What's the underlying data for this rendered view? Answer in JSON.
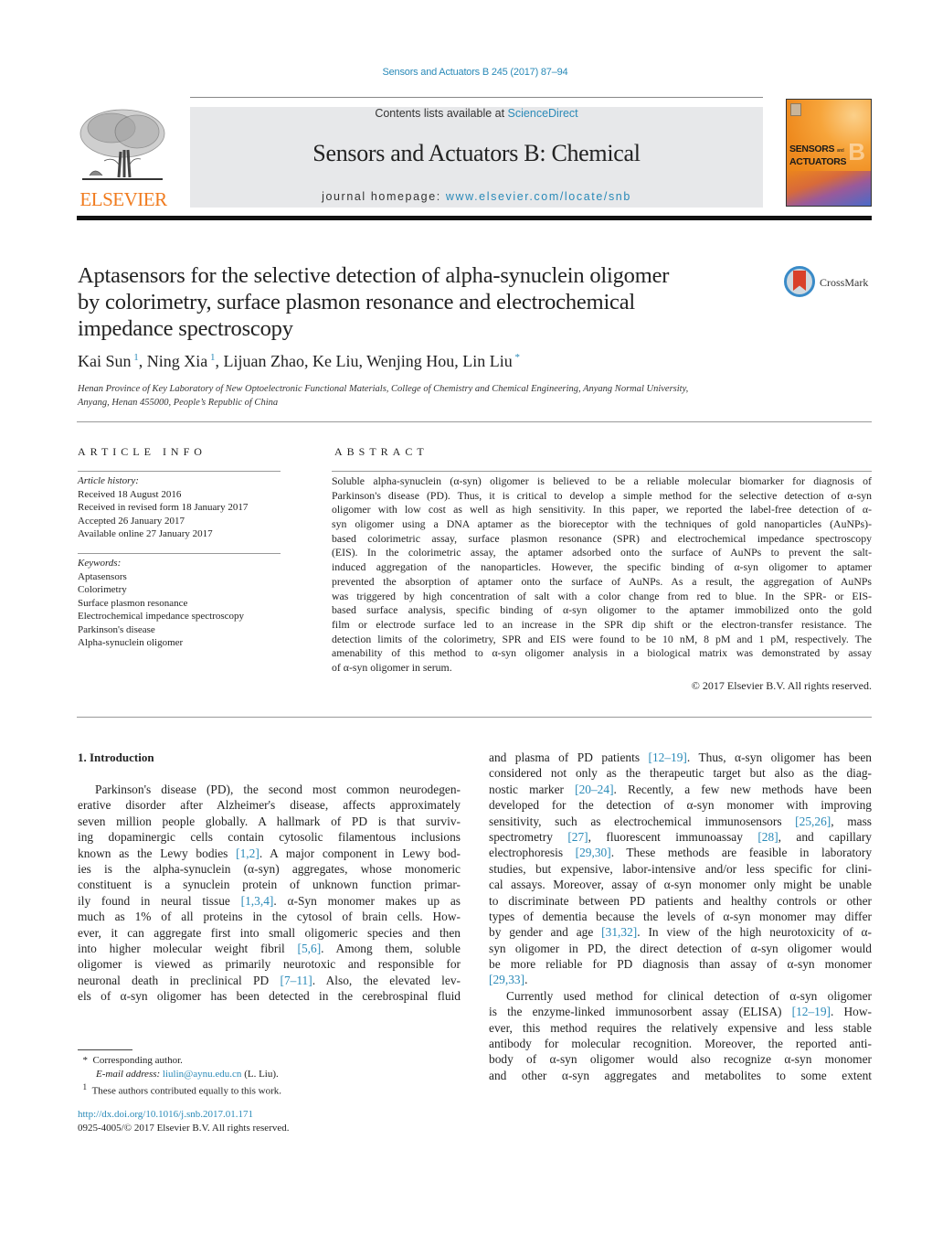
{
  "header": {
    "citation": "Sensors and Actuators B 245 (2017) 87–94",
    "contents_prefix": "Contents lists available at ",
    "contents_link": "ScienceDirect",
    "journal_title": "Sensors and Actuators B: Chemical",
    "homepage_prefix": "journal homepage: ",
    "homepage_link": "www.elsevier.com/locate/snb",
    "publisher_logo_text": "ELSEVIER",
    "cover": {
      "line1": "SENSORS",
      "and": "and",
      "line2": "ACTUATORS",
      "letter": "B"
    },
    "colors": {
      "link": "#2a8ab8",
      "elsevier_orange": "#f07b1e",
      "banner_bg": "#e7e8ea"
    }
  },
  "article": {
    "title_lines": [
      "Aptasensors for the selective detection of alpha-synuclein oligomer",
      "by colorimetry, surface plasmon resonance and electrochemical",
      "impedance spectroscopy"
    ],
    "crossmark_label": "CrossMark",
    "authors": [
      {
        "name": "Kai Sun",
        "mark": "1"
      },
      {
        "name": "Ning Xia",
        "mark": "1"
      },
      {
        "name": "Lijuan Zhao",
        "mark": ""
      },
      {
        "name": "Ke Liu",
        "mark": ""
      },
      {
        "name": "Wenjing Hou",
        "mark": ""
      },
      {
        "name": "Lin Liu",
        "mark": "*"
      }
    ],
    "affiliation_lines": [
      "Henan Province of Key Laboratory of New Optoelectronic Functional Materials, College of Chemistry and Chemical Engineering, Anyang Normal University,",
      "Anyang, Henan 455000, People’s Republic of China"
    ]
  },
  "article_info": {
    "heading": "ARTICLE INFO",
    "history_label": "Article history:",
    "history": [
      "Received 18 August 2016",
      "Received in revised form 18 January 2017",
      "Accepted 26 January 2017",
      "Available online 27 January 2017"
    ],
    "keywords_label": "Keywords:",
    "keywords": [
      "Aptasensors",
      "Colorimetry",
      "Surface plasmon resonance",
      "Electrochemical impedance spectroscopy",
      "Parkinson's disease",
      "Alpha-synuclein oligomer"
    ]
  },
  "abstract": {
    "heading": "ABSTRACT",
    "lines": [
      "Soluble alpha-synuclein (α-syn) oligomer is believed to be a reliable molecular biomarker for diagnosis of",
      "Parkinson's disease (PD). Thus, it is critical to develop a simple method for the selective detection of α-syn",
      "oligomer with low cost as well as high sensitivity. In this paper, we reported the label-free detection of α-",
      "syn oligomer using a DNA aptamer as the bioreceptor with the techniques of gold nanoparticles (AuNPs)-",
      "based colorimetric assay, surface plasmon resonance (SPR) and electrochemical impedance spectroscopy",
      "(EIS). In the colorimetric assay, the aptamer adsorbed onto the surface of AuNPs to prevent the salt-",
      "induced aggregation of the nanoparticles. However, the specific binding of α-syn oligomer to aptamer",
      "prevented the absorption of aptamer onto the surface of AuNPs. As a result, the aggregation of AuNPs",
      "was triggered by high concentration of salt with a color change from red to blue. In the SPR- or EIS-",
      "based surface analysis, specific binding of α-syn oligomer to the aptamer immobilized onto the gold",
      "film or electrode surface led to an increase in the SPR dip shift or the electron-transfer resistance. The",
      "detection limits of the colorimetry, SPR and EIS were found to be 10 nM, 8 pM and 1 pM, respectively. The",
      "amenability of this method to α-syn oligomer analysis in a biological matrix was demonstrated by assay",
      "of α-syn oligomer in serum."
    ],
    "copyright": "© 2017 Elsevier B.V. All rights reserved."
  },
  "introduction": {
    "heading": "1.  Introduction",
    "left_column": [
      {
        "segs": [
          {
            "t": "Parkinson's disease (PD), the second most common neurodegen-"
          }
        ],
        "indent": true
      },
      {
        "segs": [
          {
            "t": "erative disorder after Alzheimer's disease, affects approximately"
          }
        ]
      },
      {
        "segs": [
          {
            "t": "seven million people globally. A hallmark of PD is that surviv-"
          }
        ]
      },
      {
        "segs": [
          {
            "t": "ing dopaminergic cells contain cytosolic filamentous inclusions"
          }
        ]
      },
      {
        "segs": [
          {
            "t": "known as the Lewy bodies "
          },
          {
            "t": "[1,2]",
            "ref": true
          },
          {
            "t": ". A major component in Lewy bod-"
          }
        ]
      },
      {
        "segs": [
          {
            "t": "ies is the alpha-synuclein (α-syn) aggregates, whose monomeric"
          }
        ]
      },
      {
        "segs": [
          {
            "t": "constituent is a synuclein protein of unknown function primar-"
          }
        ]
      },
      {
        "segs": [
          {
            "t": "ily found in neural tissue "
          },
          {
            "t": "[1,3,4]",
            "ref": true
          },
          {
            "t": ". α-Syn monomer makes up as"
          }
        ]
      },
      {
        "segs": [
          {
            "t": "much as 1% of all proteins in the cytosol of brain cells. How-"
          }
        ]
      },
      {
        "segs": [
          {
            "t": "ever, it can aggregate first into small oligomeric species and then"
          }
        ]
      },
      {
        "segs": [
          {
            "t": "into higher molecular weight fibril "
          },
          {
            "t": "[5,6]",
            "ref": true
          },
          {
            "t": ". Among them, soluble"
          }
        ]
      },
      {
        "segs": [
          {
            "t": "oligomer is viewed as primarily neurotoxic and responsible for"
          }
        ]
      },
      {
        "segs": [
          {
            "t": "neuronal death in preclinical PD "
          },
          {
            "t": "[7–11]",
            "ref": true
          },
          {
            "t": ". Also, the elevated lev-"
          }
        ]
      },
      {
        "segs": [
          {
            "t": "els of α-syn oligomer has been detected in the cerebrospinal fluid"
          }
        ]
      }
    ],
    "right_column": [
      {
        "segs": [
          {
            "t": "and plasma of PD patients "
          },
          {
            "t": "[12–19]",
            "ref": true
          },
          {
            "t": ". Thus, α-syn oligomer has been"
          }
        ]
      },
      {
        "segs": [
          {
            "t": "considered not only as the therapeutic target but also as the diag-"
          }
        ]
      },
      {
        "segs": [
          {
            "t": "nostic marker "
          },
          {
            "t": "[20–24]",
            "ref": true
          },
          {
            "t": ". Recently, a few new methods have been"
          }
        ]
      },
      {
        "segs": [
          {
            "t": "developed for the detection of α-syn monomer with improving"
          }
        ]
      },
      {
        "segs": [
          {
            "t": "sensitivity, such as electrochemical immunosensors "
          },
          {
            "t": "[25,26]",
            "ref": true
          },
          {
            "t": ", mass"
          }
        ]
      },
      {
        "segs": [
          {
            "t": "spectrometry "
          },
          {
            "t": "[27]",
            "ref": true
          },
          {
            "t": ", fluorescent immunoassay "
          },
          {
            "t": "[28]",
            "ref": true
          },
          {
            "t": ", and capillary"
          }
        ]
      },
      {
        "segs": [
          {
            "t": "electrophoresis "
          },
          {
            "t": "[29,30]",
            "ref": true
          },
          {
            "t": ". These methods are feasible in laboratory"
          }
        ]
      },
      {
        "segs": [
          {
            "t": "studies, but expensive, labor-intensive and/or less specific for clini-"
          }
        ]
      },
      {
        "segs": [
          {
            "t": "cal assays. Moreover, assay of α-syn monomer only might be unable"
          }
        ]
      },
      {
        "segs": [
          {
            "t": "to discriminate between PD patients and healthy controls or other"
          }
        ]
      },
      {
        "segs": [
          {
            "t": "types of dementia because the levels of α-syn monomer may differ"
          }
        ]
      },
      {
        "segs": [
          {
            "t": "by gender and age "
          },
          {
            "t": "[31,32]",
            "ref": true
          },
          {
            "t": ". In view of the high neurotoxicity of α-"
          }
        ]
      },
      {
        "segs": [
          {
            "t": "syn oligomer in PD, the direct detection of α-syn oligomer would"
          }
        ]
      },
      {
        "segs": [
          {
            "t": "be more reliable for PD diagnosis than assay of α-syn monomer"
          }
        ]
      },
      {
        "segs": [
          {
            "t": "[29,33]",
            "ref": true
          },
          {
            "t": "."
          }
        ],
        "last": true
      },
      {
        "segs": [
          {
            "t": "Currently used method for clinical detection of α-syn oligomer"
          }
        ],
        "indent": true
      },
      {
        "segs": [
          {
            "t": "is the enzyme-linked immunosorbent assay (ELISA) "
          },
          {
            "t": "[12–19]",
            "ref": true
          },
          {
            "t": ". How-"
          }
        ]
      },
      {
        "segs": [
          {
            "t": "ever, this method requires the relatively expensive and less stable"
          }
        ]
      },
      {
        "segs": [
          {
            "t": "antibody for molecular recognition. Moreover, the reported anti-"
          }
        ]
      },
      {
        "segs": [
          {
            "t": "body of α-syn oligomer would also recognize α-syn monomer"
          }
        ]
      },
      {
        "segs": [
          {
            "t": "and other α-syn aggregates and metabolites to some extent"
          }
        ]
      }
    ]
  },
  "footnotes": {
    "corresponding_mark": "*",
    "corresponding_text": "Corresponding author.",
    "email_label": "E-mail address: ",
    "email": "liulin@aynu.edu.cn",
    "email_suffix": " (L. Liu).",
    "equal_mark": "1",
    "equal_text": "These authors contributed equally to this work."
  },
  "doi": {
    "link": "http://dx.doi.org/10.1016/j.snb.2017.01.171",
    "issn_line": "0925-4005/© 2017 Elsevier B.V. All rights reserved."
  }
}
